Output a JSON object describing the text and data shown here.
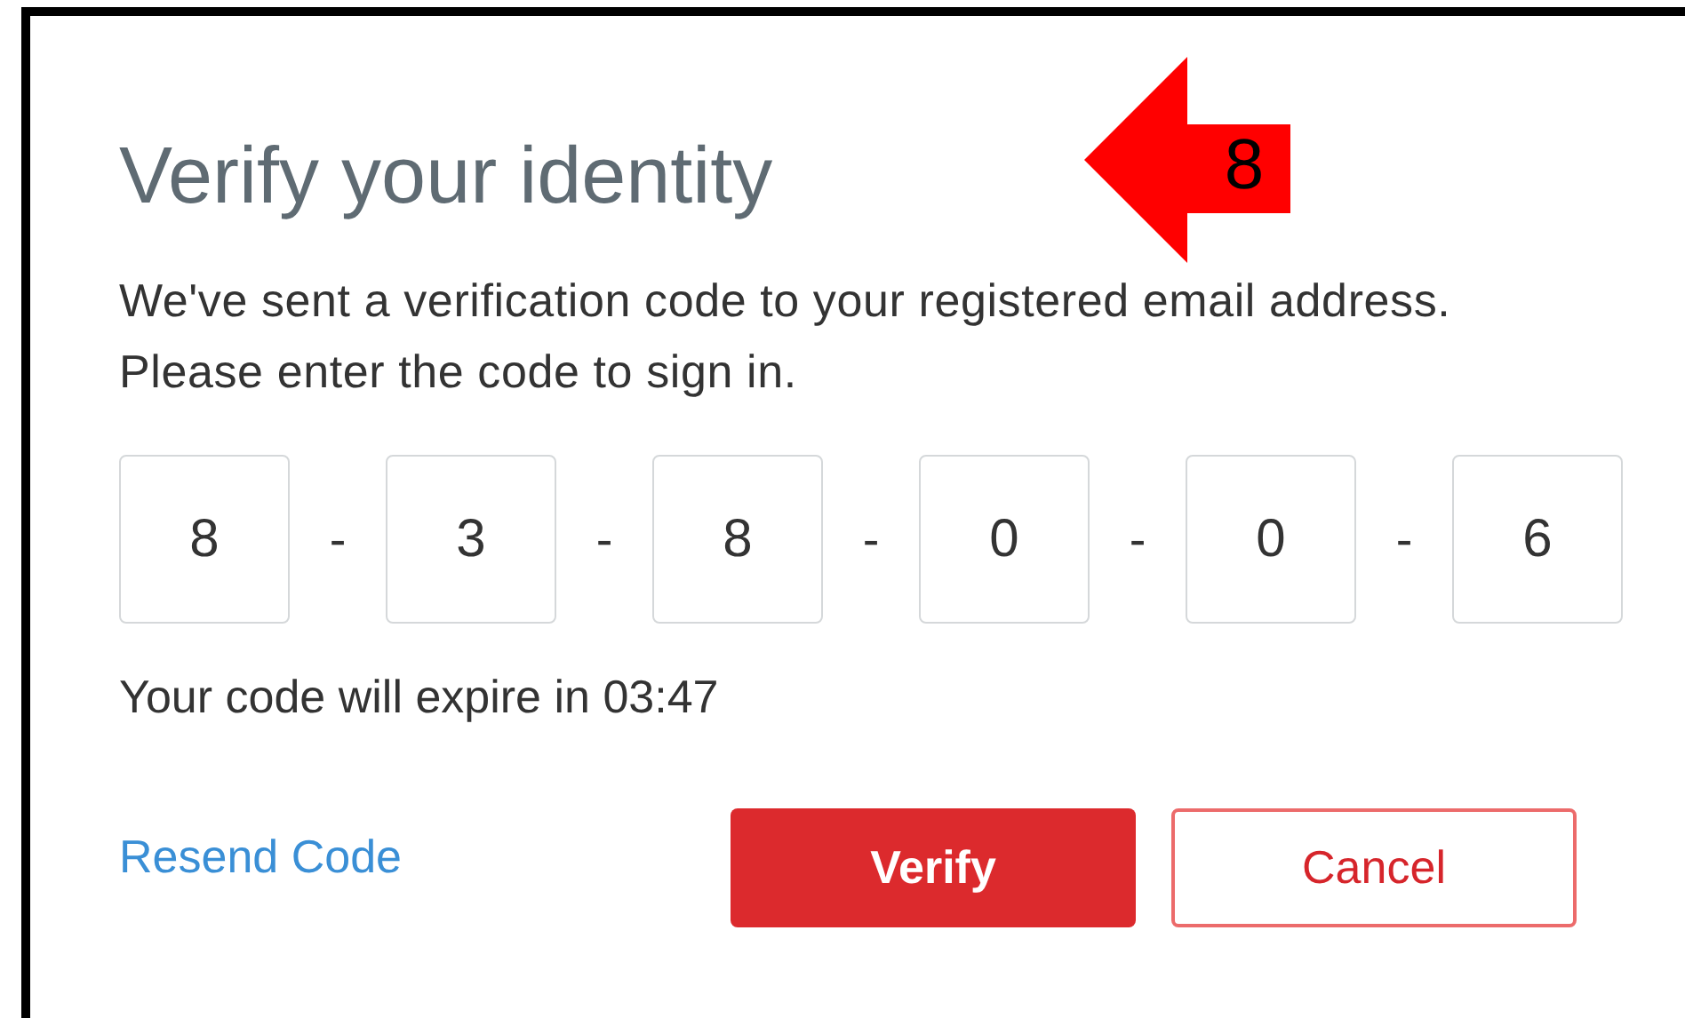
{
  "dialog": {
    "title": "Verify your identity",
    "message": "We've sent a verification code to your registered email address. Please enter the code to sign in.",
    "code_digits": [
      "8",
      "3",
      "8",
      "0",
      "0",
      "6"
    ],
    "separator": "-",
    "expiry": "Your code will expire in 03:47",
    "resend_link": "Resend Code",
    "buttons": [
      {
        "label": "Verify",
        "kind": "primary"
      },
      {
        "label": "Cancel",
        "kind": "secondary"
      }
    ]
  },
  "annotation": {
    "label": "8"
  }
}
